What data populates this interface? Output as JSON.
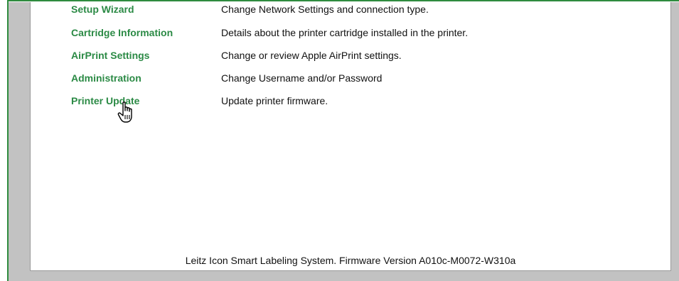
{
  "menu": {
    "items": [
      {
        "label": "Setup Wizard",
        "description": "Change Network Settings and connection type."
      },
      {
        "label": "Cartridge Information",
        "description": "Details about the printer cartridge installed in the printer."
      },
      {
        "label": "AirPrint Settings",
        "description": "Change or review Apple AirPrint settings."
      },
      {
        "label": "Administration",
        "description": "Change Username and/or Password"
      },
      {
        "label": "Printer Update",
        "description": "Update printer firmware."
      }
    ]
  },
  "footer": {
    "text": "Leitz Icon Smart Labeling System. Firmware Version A010c-M0072-W310a"
  },
  "colors": {
    "link": "#2b8a45",
    "frame": "#2e8b3e",
    "background_band": "#c2c2c2"
  },
  "icons": {
    "cursor": "hand-pointer-icon"
  }
}
